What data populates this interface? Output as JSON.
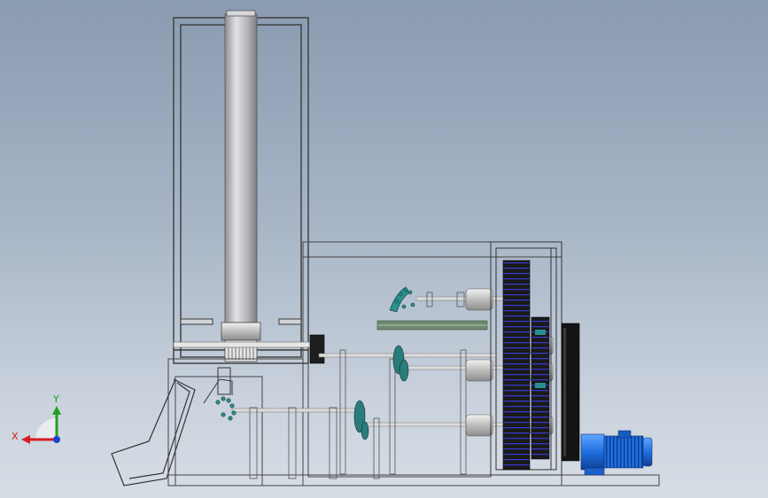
{
  "viewport": {
    "background_top": "#8a9bb1",
    "background_bottom": "#d7dde5"
  },
  "model": {
    "frame_color": "#333333",
    "column_color": "#b9b9bd",
    "motor_color": "#1f6fe0",
    "gear_color": "#1c1c1c",
    "gear_accent": "#3b3bd6",
    "sprocket_color": "#2a8f8f",
    "shaft_color": "#cfcfcf"
  },
  "triad": {
    "x_label": "X",
    "y_label": "Y",
    "x_color": "#d42020",
    "y_color": "#20a020",
    "z_color": "#2040d0"
  }
}
